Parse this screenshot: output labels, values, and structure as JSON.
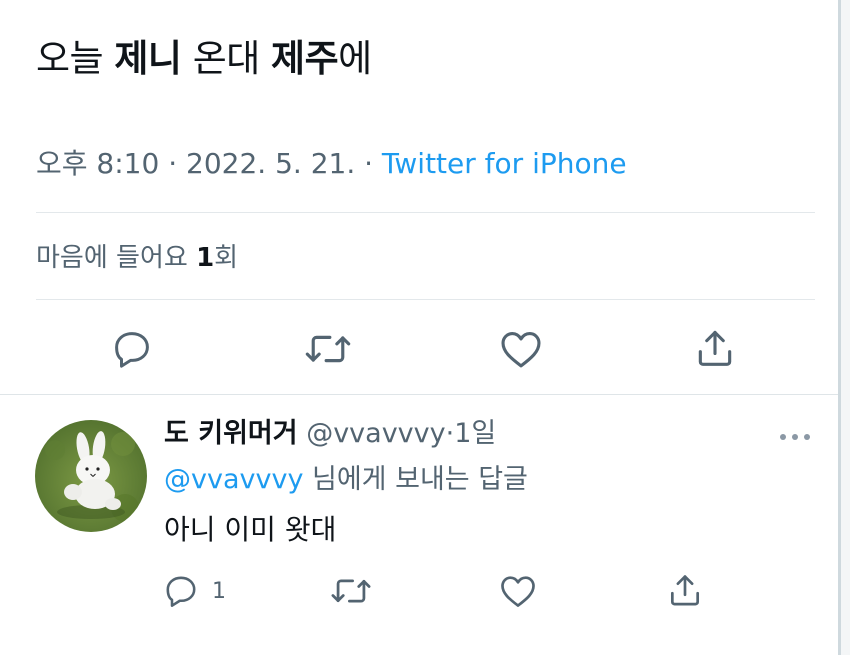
{
  "tweet": {
    "text_parts": [
      "오늘 ",
      "제니",
      " 온대 ",
      "제주",
      "에"
    ],
    "time": "오후 8:10",
    "separator": " · ",
    "date": "2022. 5. 21.",
    "source": "Twitter for iPhone",
    "likes_label": "마음에 들어요 ",
    "likes_count": "1",
    "likes_unit": "회"
  },
  "actions": {
    "reply_icon": "comment-icon",
    "retweet_icon": "retweet-icon",
    "like_icon": "heart-icon",
    "share_icon": "share-icon"
  },
  "reply": {
    "display_name": "도 키위머거",
    "handle": "@vvavvvy",
    "separator": "·",
    "age": "1일",
    "replying_mention": "@vvavvvy",
    "replying_suffix": " 님에게 보내는 답글",
    "text": "아니 이미 왓대",
    "reply_count": "1",
    "more_icon": "more-dots-icon"
  },
  "colors": {
    "text": "#0f1419",
    "secondary": "#536471",
    "accent": "#1d9bf0",
    "divider": "#e3e8eb"
  }
}
